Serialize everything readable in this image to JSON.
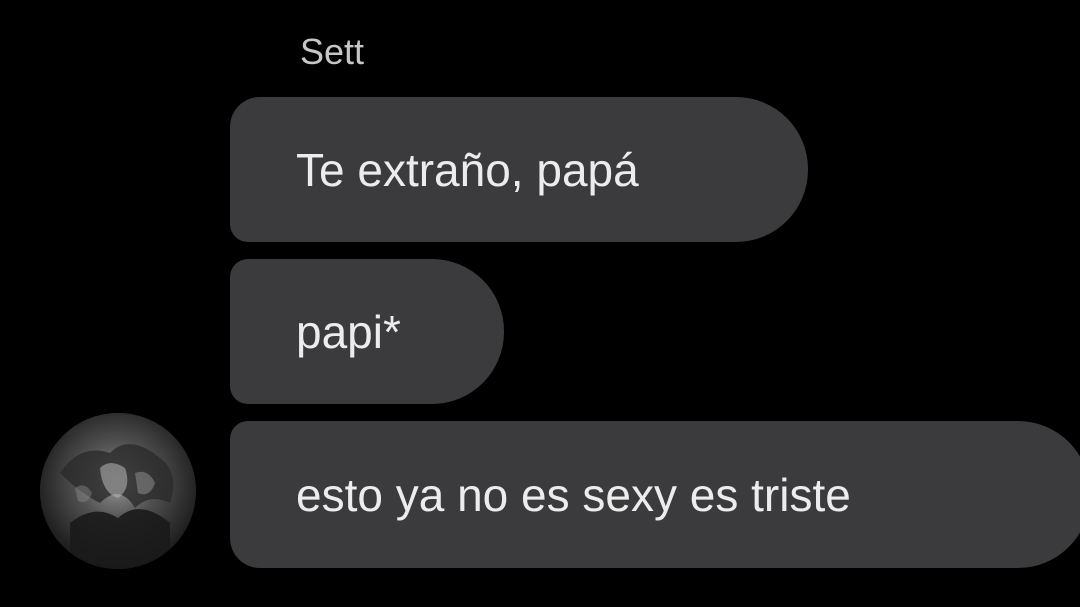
{
  "conversation": {
    "sender_name": "Sett",
    "messages": [
      {
        "text": "Te extraño, papá"
      },
      {
        "text": "papi*"
      },
      {
        "text": "esto ya no es sexy es triste"
      }
    ]
  },
  "colors": {
    "background": "#000000",
    "bubble": "#3b3b3d",
    "text": "#ececec",
    "sender_name": "#c6c6c6"
  },
  "icons": {
    "avatar": "user-avatar-photo"
  }
}
